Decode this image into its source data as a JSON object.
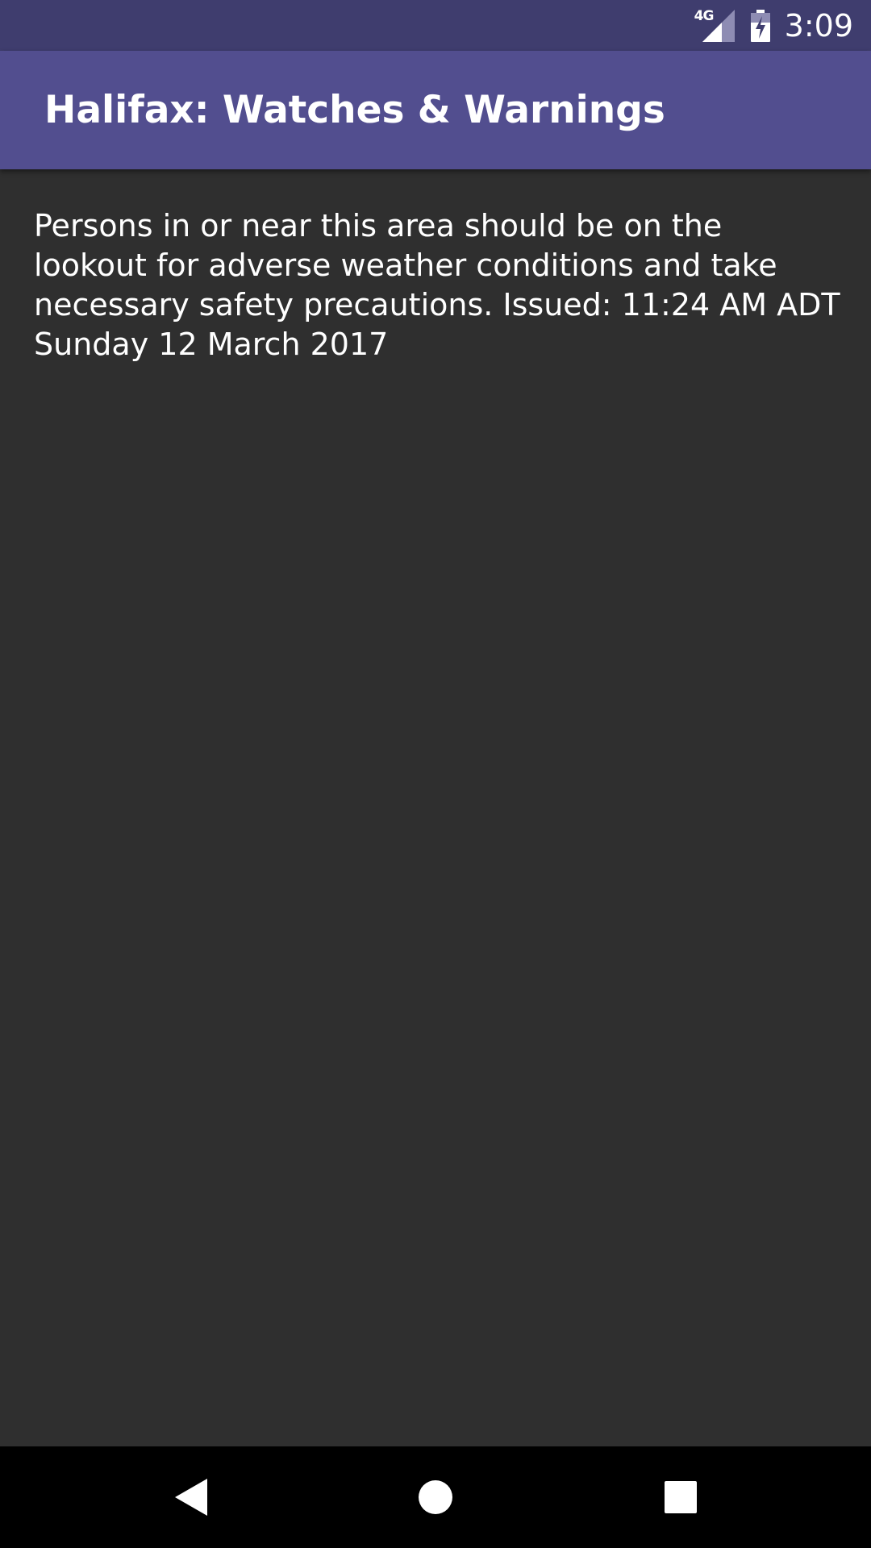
{
  "status_bar": {
    "network_type": "4G",
    "time": "3:09",
    "icons": [
      "signal-icon",
      "battery-charging-icon"
    ]
  },
  "app_bar": {
    "title": "Halifax: Watches & Warnings"
  },
  "content": {
    "warning_text": "Persons in or near this area should be on the lookout for adverse weather conditions and take necessary safety precautions. Issued: 11:24 AM ADT Sunday 12 March 2017"
  },
  "nav_bar": {
    "buttons": [
      "back-icon",
      "home-icon",
      "recents-icon"
    ]
  },
  "colors": {
    "status_bar": "#3f3d6e",
    "app_bar": "#524e8f",
    "background": "#2f2f2f",
    "nav_bar": "#000000",
    "text": "#ffffff"
  }
}
